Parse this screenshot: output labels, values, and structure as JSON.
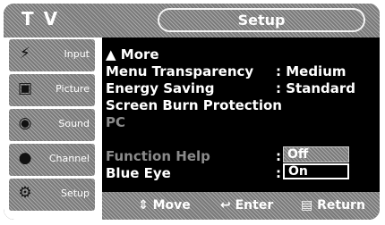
{
  "header": {
    "left_label": "T V",
    "title": "Setup"
  },
  "sidebar": {
    "items": [
      {
        "label": "Input",
        "icon": "input-icon"
      },
      {
        "label": "Picture",
        "icon": "picture-icon"
      },
      {
        "label": "Sound",
        "icon": "sound-icon"
      },
      {
        "label": "Channel",
        "icon": "channel-icon"
      },
      {
        "label": "Setup",
        "icon": "setup-icon"
      }
    ]
  },
  "menu": {
    "more": "More",
    "rows": [
      {
        "label": "Menu Transparency",
        "value": ": Medium"
      },
      {
        "label": "Energy Saving",
        "value": ": Standard"
      },
      {
        "label": "Screen Burn Protection",
        "value": ""
      },
      {
        "label": "PC",
        "value": ""
      },
      {
        "label": "Function Help",
        "value": ":"
      },
      {
        "label": "Blue Eye",
        "value": ":"
      }
    ],
    "options": [
      "Off",
      "On"
    ],
    "selected_option": "On"
  },
  "footer": {
    "move": "Move",
    "enter": "Enter",
    "return": "Return"
  }
}
